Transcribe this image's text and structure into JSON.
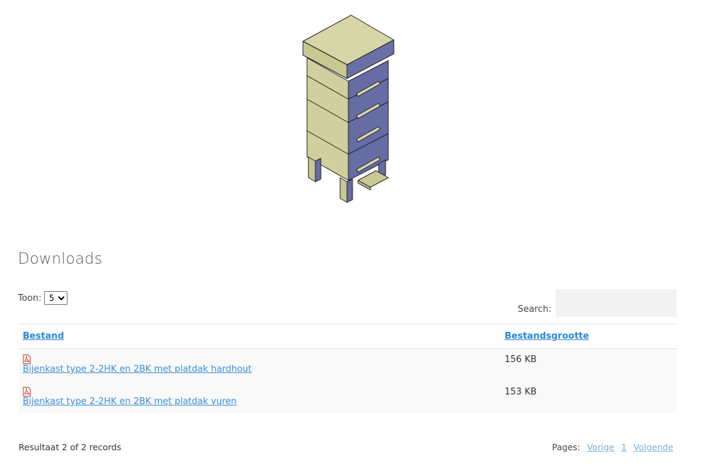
{
  "section": {
    "title": "Downloads"
  },
  "toon": {
    "label": "Toon:",
    "selected": "5"
  },
  "search": {
    "label": "Search:",
    "value": ""
  },
  "table": {
    "headers": {
      "file": "Bestand",
      "size": "Bestandsgrootte"
    },
    "rows": [
      {
        "name": "Bijenkast type 2-2HK en 2BK met platdak hardhout",
        "size": "156 KB",
        "icon": "pdf-icon"
      },
      {
        "name": "Bijenkast type 2-2HK en 2BK met platdak vuren",
        "size": "153 KB",
        "icon": "pdf-icon"
      }
    ]
  },
  "footer": {
    "result": "Resultaat 2 of 2 records",
    "pages_label": "Pages:",
    "prev": "Vorige",
    "page": "1",
    "next": "Volgende"
  },
  "colors": {
    "link": "#2a86d8",
    "lid": "#d8d8a8",
    "drawer": "#6b72a8"
  }
}
